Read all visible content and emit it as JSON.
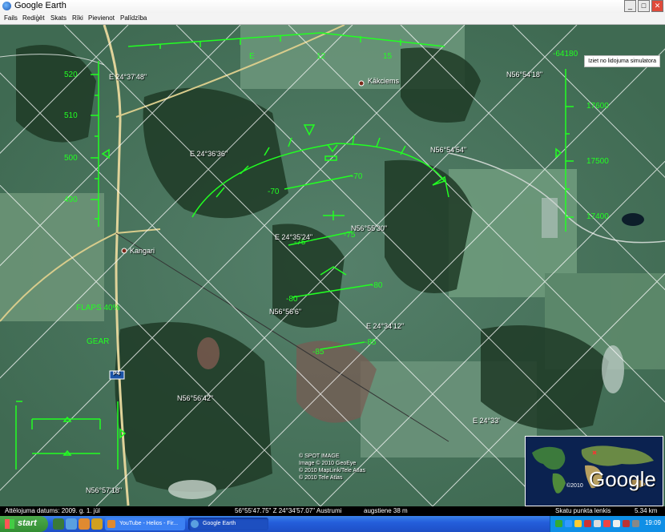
{
  "window": {
    "title": "Google Earth",
    "controls": [
      "_",
      "□",
      "✕"
    ]
  },
  "menu": [
    "Fails",
    "Rediģēt",
    "Skats",
    "Rīki",
    "Pievienot",
    "Palīdzība"
  ],
  "simulator": {
    "exit_button": "Iziet no lidojuma simulatora"
  },
  "hud": {
    "heading_labels": [
      "E",
      "12",
      "15"
    ],
    "altitude_labels": [
      "-64180",
      "17600",
      "17500",
      "17400"
    ],
    "speed_labels": [
      "520",
      "510",
      "500",
      "490"
    ],
    "pitch_labels": [
      "-70",
      "-70",
      "-75",
      "-75",
      "-80",
      "-80",
      "-85",
      "-85"
    ],
    "flaps": "FLAPS 40%",
    "gear": "GEAR"
  },
  "places": {
    "kakciems": "Kākciems",
    "kangari": "Kangari",
    "road": "P4"
  },
  "grid_labels": [
    "E 24°37'48\"",
    "N56°54'18\"",
    "E 24°36'36\"",
    "N56°54'54\"",
    "E 24°35'24\"",
    "N56°55'30\"",
    "N56°56'6\"",
    "E 24°34'12\"",
    "N56°56'42\"",
    "E 24°33'",
    "N56°57'18\""
  ],
  "attribution": [
    "© SPOT IMAGE",
    "Image © 2010 GeoEye",
    "© 2010 MapLink/Tele Atlas",
    "© 2010 Tele Atlas"
  ],
  "minimap": {
    "watermark": "Google",
    "copyright": "©2010"
  },
  "status": {
    "imagery_date": "Attēlojuma datums: 2009. g. 1. jūl",
    "coords": "56°55'47.75\" Z   24°34'57.07\" Austrumi",
    "elevation": "augstiene  38 m",
    "eye_label": "Skatu punkta lenkis",
    "eye_value": "5.34 km"
  },
  "taskbar": {
    "start": "start",
    "tasks": [
      "YouTube - Helios - Fir...",
      "Google Earth"
    ],
    "clock": "19:09"
  },
  "colors": {
    "hud": "#22ff22",
    "map_base": "#4f7a5c",
    "taskbar": "#245edb"
  }
}
